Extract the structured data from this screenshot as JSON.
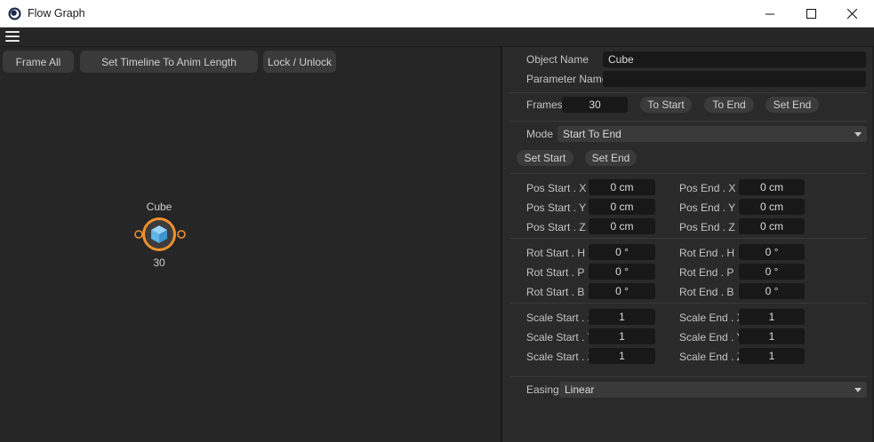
{
  "window": {
    "title": "Flow Graph"
  },
  "toolbar": {
    "frame_all": "Frame All",
    "set_timeline": "Set Timeline To Anim Length",
    "lock_unlock": "Lock / Unlock"
  },
  "node": {
    "label": "Cube",
    "count": "30",
    "accent": "#f0922e",
    "icon_color": "#5fb4e8"
  },
  "props": {
    "object_name_label": "Object Name",
    "object_name_value": "Cube",
    "parameter_name_label": "Parameter Name",
    "parameter_name_value": "",
    "frames_label": "Frames",
    "frames_value": "30",
    "to_start": "To Start",
    "to_end": "To End",
    "set_end_top": "Set End",
    "mode_label": "Mode",
    "mode_value": "Start To End",
    "set_start": "Set Start",
    "set_end": "Set End",
    "pos": {
      "start_x_label": "Pos Start . X",
      "start_x": "0 cm",
      "start_y_label": "Pos Start . Y",
      "start_y": "0 cm",
      "start_z_label": "Pos Start . Z",
      "start_z": "0 cm",
      "end_x_label": "Pos End . X",
      "end_x": "0 cm",
      "end_y_label": "Pos End . Y",
      "end_y": "0 cm",
      "end_z_label": "Pos End . Z",
      "end_z": "0 cm"
    },
    "rot": {
      "start_h_label": "Rot Start . H",
      "start_h": "0 °",
      "start_p_label": "Rot Start . P",
      "start_p": "0 °",
      "start_b_label": "Rot Start . B",
      "start_b": "0 °",
      "end_h_label": "Rot End . H",
      "end_h": "0 °",
      "end_p_label": "Rot End . P",
      "end_p": "0 °",
      "end_b_label": "Rot End . B",
      "end_b": "0 °"
    },
    "scale": {
      "start_x_label": "Scale Start . X",
      "start_x": "1",
      "start_y_label": "Scale Start . Y",
      "start_y": "1",
      "start_z_label": "Scale Start . Z",
      "start_z": "1",
      "end_x_label": "Scale End . X",
      "end_x": "1",
      "end_y_label": "Scale End . Y",
      "end_y": "1",
      "end_z_label": "Scale End . Z",
      "end_z": "1"
    },
    "easing_label": "Easing",
    "easing_value": "Linear"
  }
}
